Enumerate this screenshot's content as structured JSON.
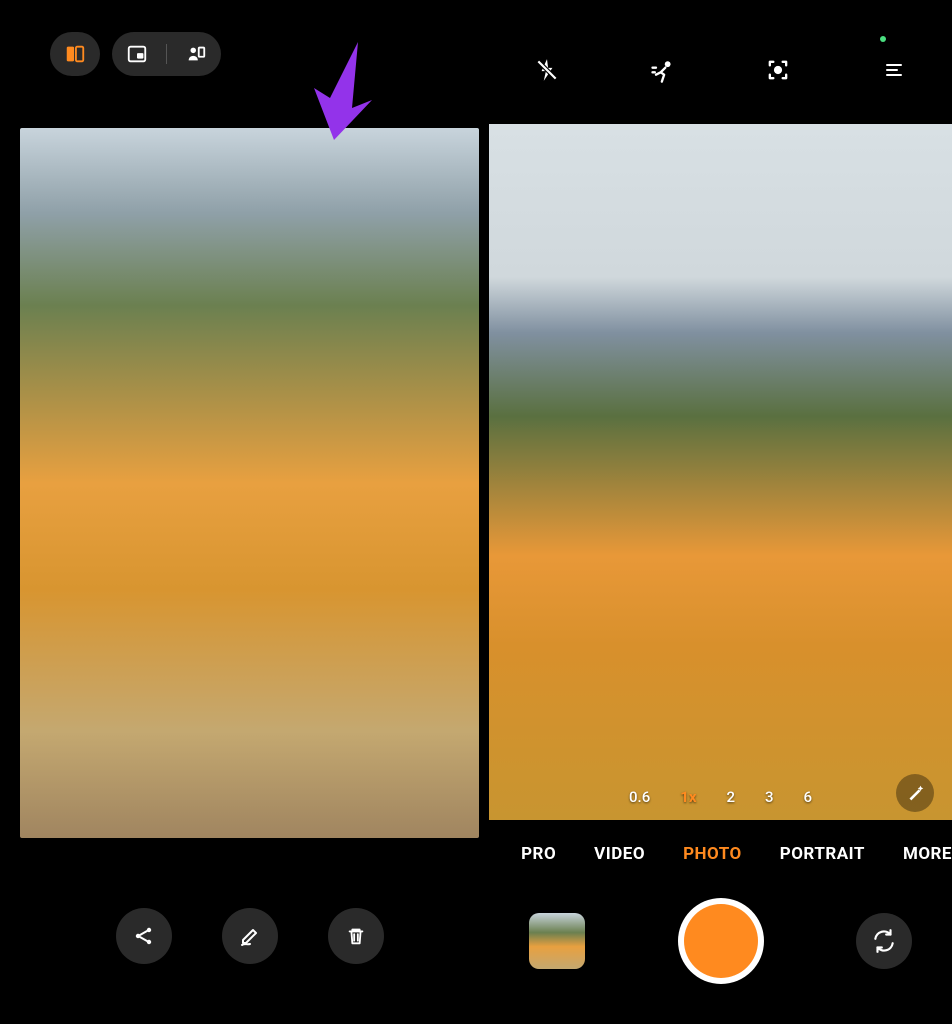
{
  "left": {
    "top_pills": {
      "split_active": true,
      "pip": false,
      "presenter": false
    },
    "actions": {
      "share": "share",
      "edit": "edit",
      "delete": "delete"
    }
  },
  "right": {
    "top_icons": {
      "flash": "flash-off",
      "motion": "motion-photo",
      "lens": "google-lens",
      "menu": "menu"
    },
    "zoom": {
      "levels": [
        "0.6",
        "1x",
        "2",
        "3",
        "6"
      ],
      "active_index": 1
    },
    "modes": {
      "items": [
        "PRO",
        "VIDEO",
        "PHOTO",
        "PORTRAIT",
        "MORE"
      ],
      "active_index": 2
    },
    "shutter_color": "#ff8a1f"
  },
  "colors": {
    "accent": "#ff8a1f",
    "arrow": "#9333ea"
  }
}
